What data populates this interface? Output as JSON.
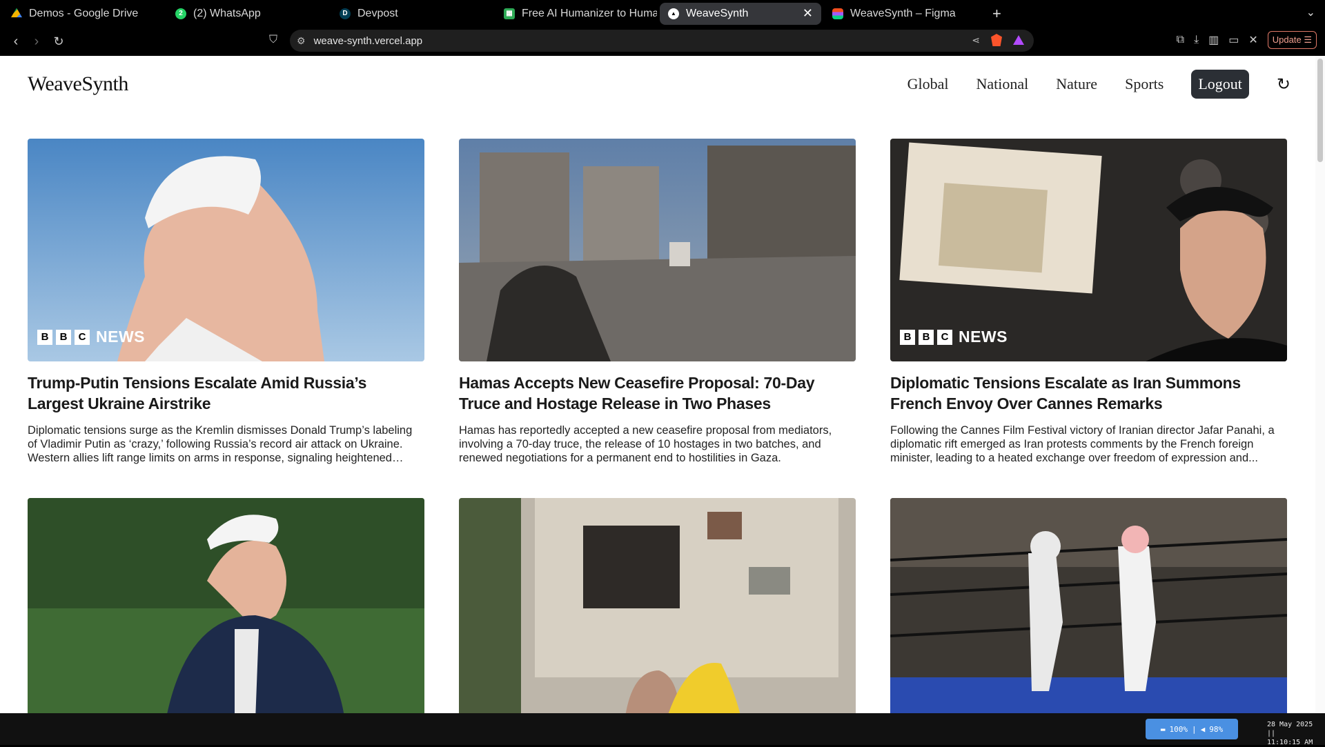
{
  "browser": {
    "tabs": [
      {
        "title": "Demos - Google Drive",
        "icon": "google-drive-icon",
        "color": "#f4b400",
        "active": false
      },
      {
        "title": "(2) WhatsApp",
        "icon": "whatsapp-icon",
        "color": "#25d366",
        "active": false
      },
      {
        "title": "Devpost",
        "icon": "devpost-icon",
        "color": "#003e54",
        "active": false
      },
      {
        "title": "Free AI Humanizer to Human",
        "icon": "humanizer-icon",
        "color": "#2eaa56",
        "active": false
      },
      {
        "title": "WeaveSynth",
        "icon": "vercel-icon",
        "color": "#000000",
        "active": true
      },
      {
        "title": "WeaveSynth – Figma",
        "icon": "figma-icon",
        "color": "#a259ff",
        "active": false
      }
    ],
    "url": "weave-synth.vercel.app",
    "update_label": "Update"
  },
  "site": {
    "logo": "WeaveSynth",
    "nav": [
      "Global",
      "National",
      "Nature",
      "Sports"
    ],
    "logout_label": "Logout"
  },
  "articles": [
    {
      "title": "Trump-Putin Tensions Escalate Amid Russia’s Largest Ukraine Airstrike",
      "summary": "Diplomatic tensions surge as the Kremlin dismisses Donald Trump’s labeling of Vladimir Putin as ‘crazy,’ following Russia’s record air attack on Ukraine. Western allies lift range limits on arms in response, signaling heightened tensions.",
      "source_badge": "BBC NEWS",
      "image": "portrait-white-cap-sky"
    },
    {
      "title": "Hamas Accepts New Ceasefire Proposal: 70-Day Truce and Hostage Release in Two Phases",
      "summary": "Hamas has reportedly accepted a new ceasefire proposal from mediators, involving a 70-day truce, the release of 10 hostages in two batches, and renewed negotiations for a permanent end to hostilities in Gaza.",
      "source_badge": "",
      "image": "rubble-street"
    },
    {
      "title": "Diplomatic Tensions Escalate as Iran Summons French Envoy Over Cannes Remarks",
      "summary": "Following the Cannes Film Festival victory of Iranian director Jafar Panahi, a diplomatic rift emerged as Iran protests comments by the French foreign minister, leading to a heated exchange over freedom of expression and...",
      "source_badge": "BBC NEWS",
      "image": "award-ceremony"
    },
    {
      "title": "",
      "summary": "",
      "source_badge": "",
      "image": "portrait-navy-jacket-park"
    },
    {
      "title": "",
      "summary": "",
      "source_badge": "",
      "image": "damaged-apartment-block"
    },
    {
      "title": "",
      "summary": "",
      "source_badge": "",
      "image": "robot-boxing-ring"
    }
  ],
  "system": {
    "battery": "100%",
    "volume": "98%",
    "date": "28 May 2025 ||",
    "time": "11:10:15 AM"
  }
}
